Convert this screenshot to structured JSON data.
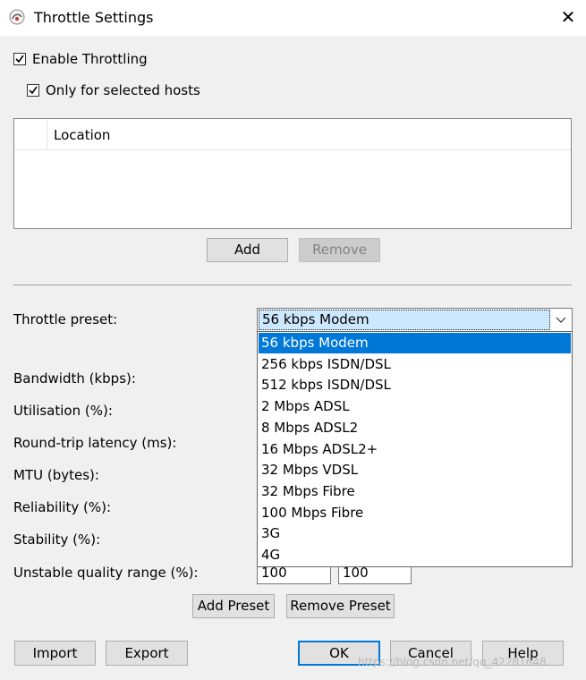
{
  "window": {
    "title": "Throttle Settings",
    "close_glyph": "✕"
  },
  "enable_throttling": {
    "label": "Enable Throttling",
    "checked": true
  },
  "only_selected_hosts": {
    "label": "Only for selected hosts",
    "checked": true
  },
  "hosts_list": {
    "column_header": "Location",
    "rows": []
  },
  "hosts_buttons": {
    "add": "Add",
    "remove": "Remove"
  },
  "preset": {
    "label": "Throttle preset:",
    "selected": "56 kbps Modem",
    "options": [
      "56 kbps Modem",
      "256 kbps ISDN/DSL",
      "512 kbps ISDN/DSL",
      "2 Mbps ADSL",
      "8 Mbps ADSL2",
      "16 Mbps ADSL2+",
      "32 Mbps VDSL",
      "32 Mbps Fibre",
      "100 Mbps Fibre",
      "3G",
      "4G"
    ],
    "selected_index": 0
  },
  "fields": {
    "bandwidth": "Bandwidth (kbps):",
    "utilisation": "Utilisation (%):",
    "latency": "Round-trip latency (ms):",
    "mtu": "MTU (bytes):",
    "reliability": "Reliability (%):",
    "stability": "Stability (%):",
    "unstable_range": {
      "label": "Unstable quality range (%):",
      "min_value": "100",
      "max_value": "100"
    }
  },
  "preset_buttons": {
    "add": "Add Preset",
    "remove": "Remove Preset"
  },
  "footer": {
    "import": "Import",
    "export": "Export",
    "ok": "OK",
    "cancel": "Cancel",
    "help": "Help"
  },
  "watermark": "https://blog.csdn.net/qq_42281648",
  "colors": {
    "accent": "#0078d7",
    "selection_bg": "#cce8ff",
    "window_bg": "#f0f0f0"
  },
  "icons": {
    "app": "app-icon",
    "close": "close-icon",
    "checkbox_check": "checkmark-icon",
    "combo_arrow": "chevron-down-icon"
  }
}
